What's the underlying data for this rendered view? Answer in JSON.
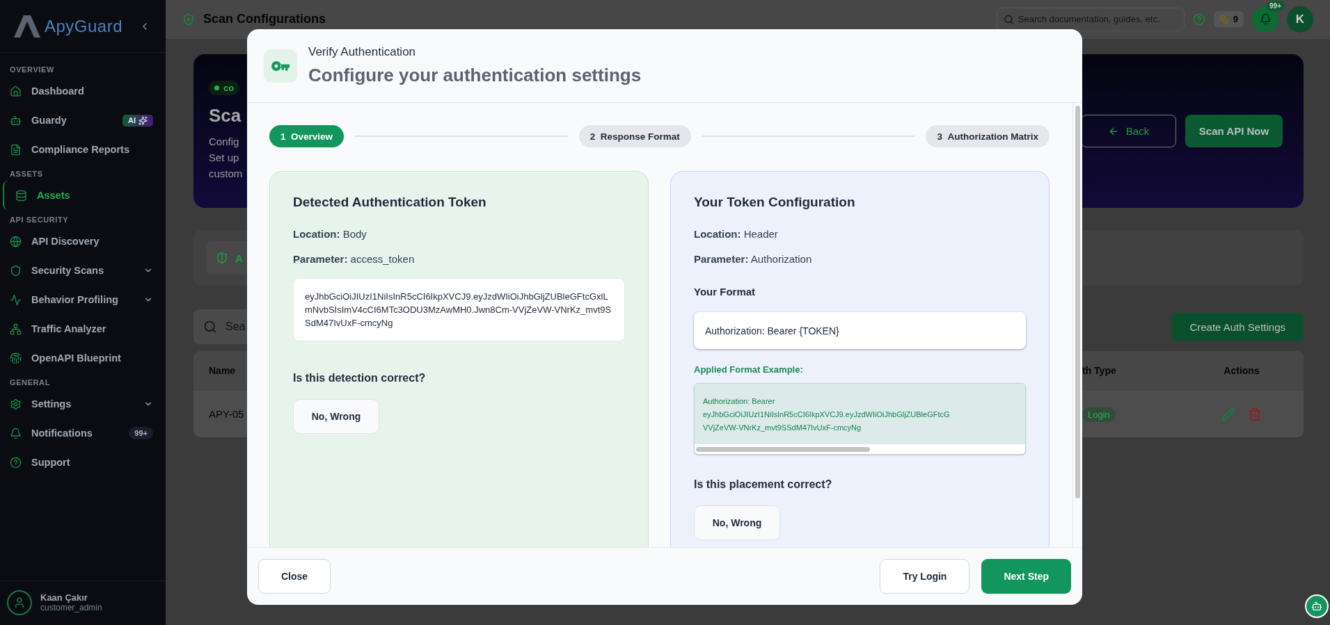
{
  "sidebar": {
    "brand": "ApyGuard",
    "sections": [
      {
        "title": "OVERVIEW",
        "items": [
          {
            "label": "Dashboard",
            "selected": false,
            "kind": "link"
          },
          {
            "label": "Guardy",
            "selected": false,
            "kind": "link",
            "badge": {
              "text": "AI",
              "kind": "ai"
            }
          },
          {
            "label": "Compliance Reports",
            "selected": false,
            "kind": "link"
          }
        ]
      },
      {
        "title": "ASSETS",
        "items": [
          {
            "label": "Assets",
            "selected": true,
            "kind": "link"
          }
        ]
      },
      {
        "title": "API SECURITY",
        "items": [
          {
            "label": "API Discovery",
            "selected": false,
            "kind": "link"
          },
          {
            "label": "Security Scans",
            "selected": false,
            "kind": "menu"
          },
          {
            "label": "Behavior Profiling",
            "selected": false,
            "kind": "menu"
          },
          {
            "label": "Traffic Analyzer",
            "selected": false,
            "kind": "link"
          },
          {
            "label": "OpenAPI Blueprint",
            "selected": false,
            "kind": "link"
          }
        ]
      },
      {
        "title": "GENERAL",
        "items": [
          {
            "label": "Settings",
            "selected": false,
            "kind": "menu"
          },
          {
            "label": "Notifications",
            "selected": false,
            "kind": "link",
            "badge": {
              "text": "99+",
              "kind": "count"
            }
          },
          {
            "label": "Support",
            "selected": false,
            "kind": "link"
          }
        ]
      }
    ],
    "user": {
      "name": "Kaan Çakır",
      "role": "customer_admin"
    }
  },
  "header": {
    "title": "Scan Configurations",
    "search_placeholder": "Search documentation, guides, etc.",
    "credits": "9",
    "notifications": "99+",
    "avatar": "K"
  },
  "page": {
    "banner": {
      "badge": "co",
      "title": "Sca",
      "description_lines": [
        "Config",
        "Set up",
        "custom"
      ],
      "back_button": "Back",
      "scan_button": "Scan API Now"
    },
    "tab": "A",
    "search_placeholder": "Sea",
    "create_button": "Create Auth Settings",
    "table": {
      "columns": [
        "Name",
        "th Type",
        "Actions"
      ],
      "rows": [
        {
          "name": "APY-05",
          "auth_type": "Login"
        }
      ]
    }
  },
  "modal": {
    "title": "Verify Authentication",
    "subtitle": "Configure your authentication settings",
    "steps": [
      {
        "number": "1",
        "label": "Overview",
        "selected": true
      },
      {
        "number": "2",
        "label": "Response Format",
        "selected": false
      },
      {
        "number": "3",
        "label": "Authorization Matrix",
        "selected": false
      }
    ],
    "detected": {
      "title": "Detected Authentication Token",
      "fields": [
        "**Location:** Body",
        "**Parameter:** access_token"
      ],
      "token": "eyJhbGciOiJIUzI1NiIsInR5cCI6IkpXVCJ9.eyJzdWIiOiJhbGljZUBleGFtcGxlLmNvbSIsImV4cCI6MTc3ODU3MzAwMH0.Jwn8Cm-VVjZeVW-VNrKz_mvt9SSdM47IvUxF-cmcyNg",
      "question": "Is this detection correct?",
      "button": "No, Wrong"
    },
    "config": {
      "title": "Your Token Configuration",
      "fields": [
        "**Location:** Header",
        "**Parameter:** Authorization"
      ],
      "format_label": "Your Format",
      "format_value": "Authorization: Bearer {TOKEN}",
      "example_label": "Applied Format Example:",
      "example_lines": [
        "Authorization: Bearer",
        "eyJhbGciOiJIUzI1NiIsInR5cCI6IkpXVCJ9.eyJzdWIiOiJhbGljZUBleGFtcG",
        "VVjZeVW-VNrKz_mvt9SSdM47IvUxF-cmcyNg"
      ],
      "question": "Is this placement correct?",
      "button": "No, Wrong"
    },
    "footer": {
      "close": "Close",
      "try_login": "Try Login",
      "next": "Next Step"
    }
  }
}
